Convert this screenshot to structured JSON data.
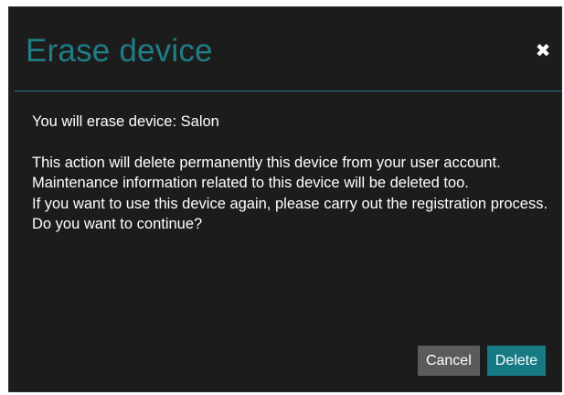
{
  "dialog": {
    "title": "Erase device",
    "close_glyph": "✖",
    "close_icon": "close-icon",
    "body": {
      "lead": "You will erase device: Salon",
      "lines": [
        "This action will delete permanently this device from your user account.",
        "Maintenance information related to this device will be deleted too.",
        "If you want to use this device again, please carry out the registration process.",
        "Do you want to continue?"
      ]
    },
    "buttons": {
      "cancel": "Cancel",
      "delete": "Delete"
    }
  },
  "colors": {
    "accent": "#1f7d86",
    "background": "#1c1c1c",
    "cancel_button": "#5b5b5b",
    "delete_button": "#167a84",
    "text": "#ffffff"
  }
}
